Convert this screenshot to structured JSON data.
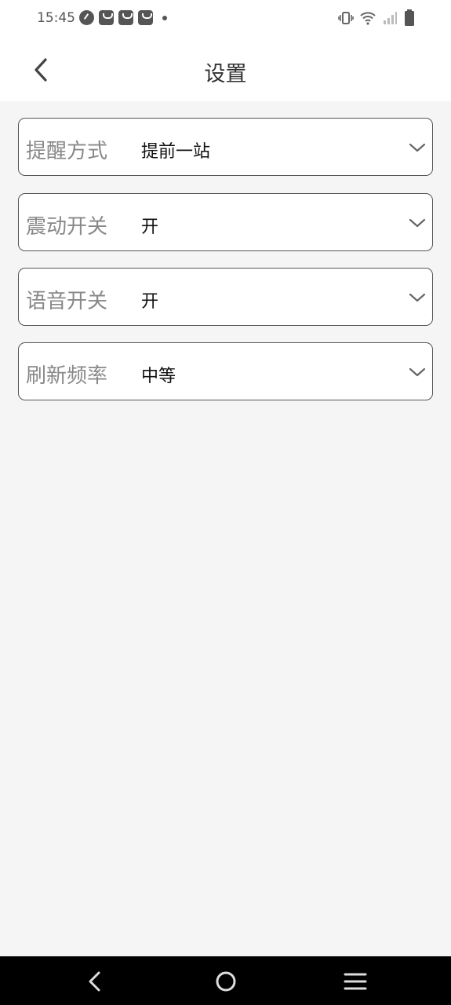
{
  "status_bar": {
    "time": "15:45",
    "notification_icons": [
      "speedometer-icon",
      "shopping-bag-icon",
      "shopping-bag-icon",
      "shopping-bag-icon",
      "more-dot-icon"
    ],
    "system_icons": [
      "vibrate-icon",
      "wifi-icon",
      "signal-icon",
      "battery-icon"
    ]
  },
  "header": {
    "title": "设置",
    "back_icon": "back-arrow-icon"
  },
  "settings": [
    {
      "label": "提醒方式",
      "value": "提前一站"
    },
    {
      "label": "震动开关",
      "value": "开"
    },
    {
      "label": "语音开关",
      "value": "开"
    },
    {
      "label": "刷新频率",
      "value": "中等"
    }
  ],
  "nav_bar": {
    "buttons": [
      "nav-back-icon",
      "nav-home-icon",
      "nav-menu-icon"
    ]
  },
  "colors": {
    "background": "#f5f5f5",
    "surface": "#ffffff",
    "border": "#555555",
    "label": "#888888",
    "value": "#111111",
    "nav_bar": "#000000"
  }
}
